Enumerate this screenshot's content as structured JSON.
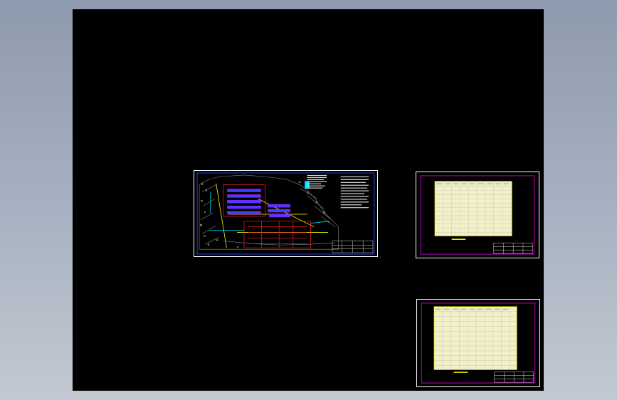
{
  "viewer": {
    "background_top": "#8e9aad",
    "background_bottom": "#c3c9d2",
    "canvas_color": "#000000"
  },
  "sheets": [
    {
      "id": "site-plan",
      "kind": "site-plan-drawing",
      "border_color": "#ffffff",
      "accent_colors": [
        "#ff2020",
        "#4040ff",
        "#00e5ff",
        "#ffff00",
        "#ff00ff"
      ]
    },
    {
      "id": "table-1",
      "kind": "table-sheet",
      "border_color": "#ffffff",
      "frame_color": "#c000c0",
      "table_fill": "#f2efc9"
    },
    {
      "id": "table-2",
      "kind": "table-sheet",
      "border_color": "#ffffff",
      "frame_color": "#c000c0",
      "table_fill": "#f2efc9"
    }
  ]
}
